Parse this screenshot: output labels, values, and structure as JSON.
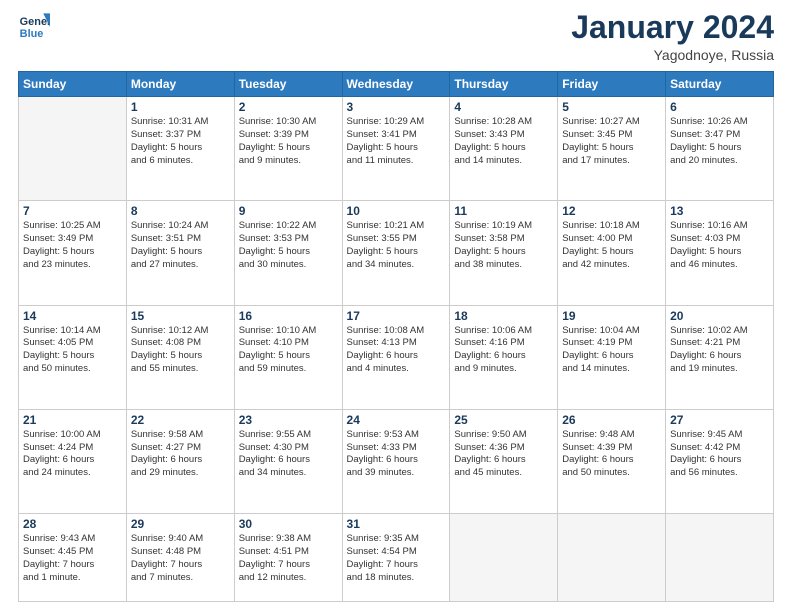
{
  "header": {
    "logo_line1": "General",
    "logo_line2": "Blue",
    "month": "January 2024",
    "location": "Yagodnoye, Russia"
  },
  "weekdays": [
    "Sunday",
    "Monday",
    "Tuesday",
    "Wednesday",
    "Thursday",
    "Friday",
    "Saturday"
  ],
  "weeks": [
    [
      {
        "day": "",
        "info": ""
      },
      {
        "day": "1",
        "info": "Sunrise: 10:31 AM\nSunset: 3:37 PM\nDaylight: 5 hours\nand 6 minutes."
      },
      {
        "day": "2",
        "info": "Sunrise: 10:30 AM\nSunset: 3:39 PM\nDaylight: 5 hours\nand 9 minutes."
      },
      {
        "day": "3",
        "info": "Sunrise: 10:29 AM\nSunset: 3:41 PM\nDaylight: 5 hours\nand 11 minutes."
      },
      {
        "day": "4",
        "info": "Sunrise: 10:28 AM\nSunset: 3:43 PM\nDaylight: 5 hours\nand 14 minutes."
      },
      {
        "day": "5",
        "info": "Sunrise: 10:27 AM\nSunset: 3:45 PM\nDaylight: 5 hours\nand 17 minutes."
      },
      {
        "day": "6",
        "info": "Sunrise: 10:26 AM\nSunset: 3:47 PM\nDaylight: 5 hours\nand 20 minutes."
      }
    ],
    [
      {
        "day": "7",
        "info": "Sunrise: 10:25 AM\nSunset: 3:49 PM\nDaylight: 5 hours\nand 23 minutes."
      },
      {
        "day": "8",
        "info": "Sunrise: 10:24 AM\nSunset: 3:51 PM\nDaylight: 5 hours\nand 27 minutes."
      },
      {
        "day": "9",
        "info": "Sunrise: 10:22 AM\nSunset: 3:53 PM\nDaylight: 5 hours\nand 30 minutes."
      },
      {
        "day": "10",
        "info": "Sunrise: 10:21 AM\nSunset: 3:55 PM\nDaylight: 5 hours\nand 34 minutes."
      },
      {
        "day": "11",
        "info": "Sunrise: 10:19 AM\nSunset: 3:58 PM\nDaylight: 5 hours\nand 38 minutes."
      },
      {
        "day": "12",
        "info": "Sunrise: 10:18 AM\nSunset: 4:00 PM\nDaylight: 5 hours\nand 42 minutes."
      },
      {
        "day": "13",
        "info": "Sunrise: 10:16 AM\nSunset: 4:03 PM\nDaylight: 5 hours\nand 46 minutes."
      }
    ],
    [
      {
        "day": "14",
        "info": "Sunrise: 10:14 AM\nSunset: 4:05 PM\nDaylight: 5 hours\nand 50 minutes."
      },
      {
        "day": "15",
        "info": "Sunrise: 10:12 AM\nSunset: 4:08 PM\nDaylight: 5 hours\nand 55 minutes."
      },
      {
        "day": "16",
        "info": "Sunrise: 10:10 AM\nSunset: 4:10 PM\nDaylight: 5 hours\nand 59 minutes."
      },
      {
        "day": "17",
        "info": "Sunrise: 10:08 AM\nSunset: 4:13 PM\nDaylight: 6 hours\nand 4 minutes."
      },
      {
        "day": "18",
        "info": "Sunrise: 10:06 AM\nSunset: 4:16 PM\nDaylight: 6 hours\nand 9 minutes."
      },
      {
        "day": "19",
        "info": "Sunrise: 10:04 AM\nSunset: 4:19 PM\nDaylight: 6 hours\nand 14 minutes."
      },
      {
        "day": "20",
        "info": "Sunrise: 10:02 AM\nSunset: 4:21 PM\nDaylight: 6 hours\nand 19 minutes."
      }
    ],
    [
      {
        "day": "21",
        "info": "Sunrise: 10:00 AM\nSunset: 4:24 PM\nDaylight: 6 hours\nand 24 minutes."
      },
      {
        "day": "22",
        "info": "Sunrise: 9:58 AM\nSunset: 4:27 PM\nDaylight: 6 hours\nand 29 minutes."
      },
      {
        "day": "23",
        "info": "Sunrise: 9:55 AM\nSunset: 4:30 PM\nDaylight: 6 hours\nand 34 minutes."
      },
      {
        "day": "24",
        "info": "Sunrise: 9:53 AM\nSunset: 4:33 PM\nDaylight: 6 hours\nand 39 minutes."
      },
      {
        "day": "25",
        "info": "Sunrise: 9:50 AM\nSunset: 4:36 PM\nDaylight: 6 hours\nand 45 minutes."
      },
      {
        "day": "26",
        "info": "Sunrise: 9:48 AM\nSunset: 4:39 PM\nDaylight: 6 hours\nand 50 minutes."
      },
      {
        "day": "27",
        "info": "Sunrise: 9:45 AM\nSunset: 4:42 PM\nDaylight: 6 hours\nand 56 minutes."
      }
    ],
    [
      {
        "day": "28",
        "info": "Sunrise: 9:43 AM\nSunset: 4:45 PM\nDaylight: 7 hours\nand 1 minute."
      },
      {
        "day": "29",
        "info": "Sunrise: 9:40 AM\nSunset: 4:48 PM\nDaylight: 7 hours\nand 7 minutes."
      },
      {
        "day": "30",
        "info": "Sunrise: 9:38 AM\nSunset: 4:51 PM\nDaylight: 7 hours\nand 12 minutes."
      },
      {
        "day": "31",
        "info": "Sunrise: 9:35 AM\nSunset: 4:54 PM\nDaylight: 7 hours\nand 18 minutes."
      },
      {
        "day": "",
        "info": ""
      },
      {
        "day": "",
        "info": ""
      },
      {
        "day": "",
        "info": ""
      }
    ]
  ]
}
